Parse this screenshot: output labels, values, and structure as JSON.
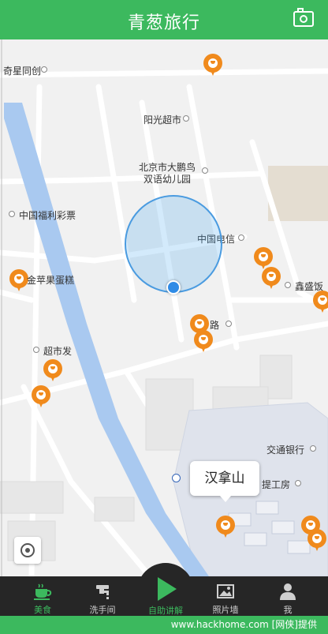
{
  "header": {
    "title": "青葱旅行",
    "camera_icon": "camera-icon"
  },
  "map": {
    "labels": {
      "qixing": "奇星同创",
      "yangguang": "阳光超市",
      "beijing_kindergarten_1": "北京市大鹏鸟",
      "beijing_kindergarten_2": "双语幼儿园",
      "zhongguo_fuli": "中国福利彩票",
      "zhongguo_dianxin": "中国电信",
      "jinpingguo": "金苹果蛋糕",
      "xinsheng": "鑫盛饭",
      "road_label": "路",
      "chaoshi_fa": "超市发",
      "jiaotong_yinhang": "交通银行",
      "ti_gongfang": "提工房"
    },
    "callout": "汉拿山",
    "locate_icon": "crosshair-icon"
  },
  "tabbar": {
    "tabs": [
      {
        "label": "美食",
        "icon": "coffee-cup-icon",
        "active": true
      },
      {
        "label": "洗手间",
        "icon": "faucet-icon",
        "active": false
      },
      {
        "label": "自助讲解",
        "icon": "play-icon",
        "active": false
      },
      {
        "label": "照片墙",
        "icon": "photo-icon",
        "active": false
      },
      {
        "label": "我",
        "icon": "person-icon",
        "active": false
      }
    ]
  },
  "footer": {
    "text": "www.hackhome.com [网侠]提供"
  },
  "colors": {
    "primary_green": "#3cb95e",
    "pin_orange": "#f08a1c",
    "tabbar_dark": "#262626"
  }
}
